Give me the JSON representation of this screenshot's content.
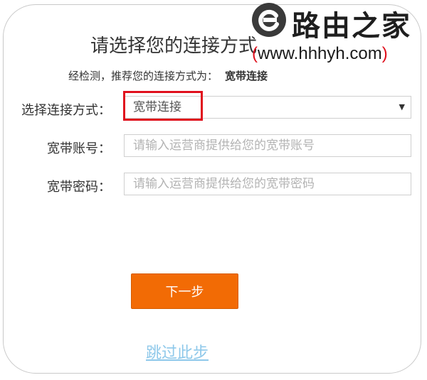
{
  "dialog": {
    "title": "请选择您的连接方式",
    "recommend_prefix": "经检测，推荐您的连接方式为：",
    "recommend_value": "宽带连接",
    "fields": {
      "connection_type": {
        "label": "选择连接方式：",
        "value": "宽带连接",
        "arrow_icon": "triangle-down"
      },
      "account": {
        "label": "宽带账号：",
        "placeholder": "请输入运营商提供给您的宽带账号",
        "value": ""
      },
      "password": {
        "label": "宽带密码：",
        "placeholder": "请输入运营商提供给您的宽带密码",
        "value": ""
      }
    },
    "next_button": "下一步",
    "skip_link": "跳过此步",
    "highlight_color": "#e0101d",
    "accent_color": "#f26b05",
    "link_color": "#8ec8ea"
  },
  "watermark": {
    "brand": "路由之家",
    "url_open": "(",
    "url_text": "www.hhhyh.com",
    "url_close": ")",
    "logo_icon": "router-e-logo"
  }
}
